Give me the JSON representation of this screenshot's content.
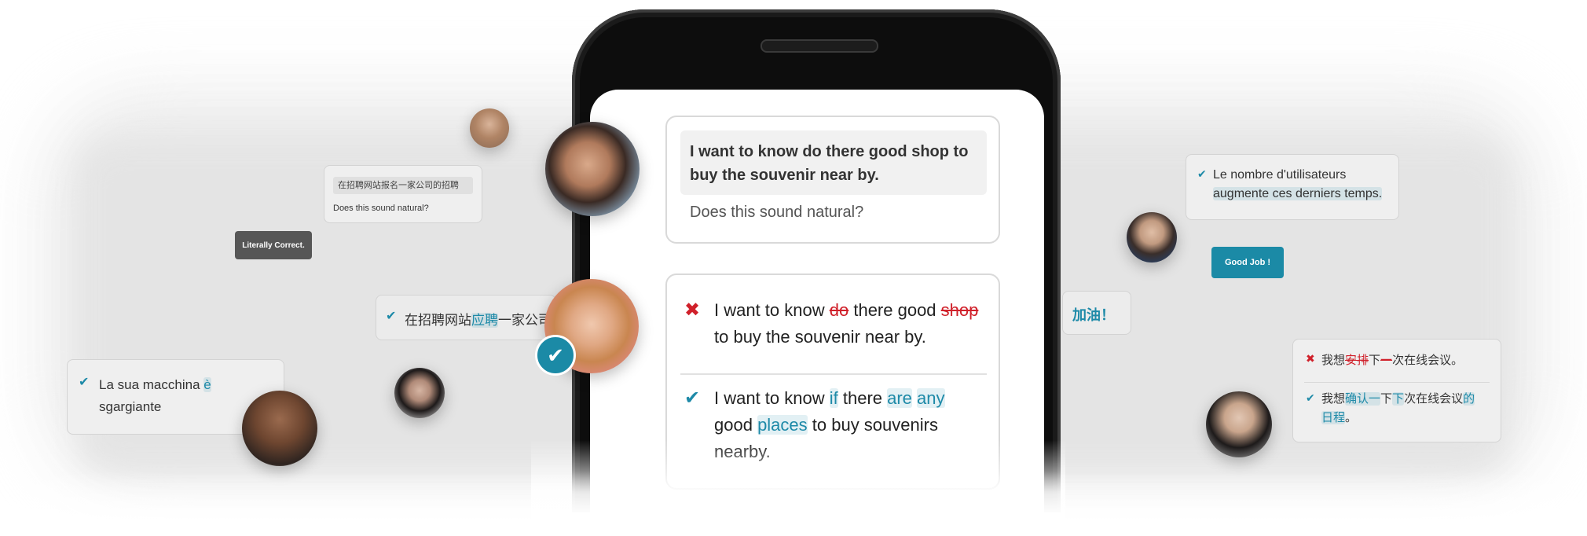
{
  "left": {
    "chinese_question": {
      "text": "在招聘网站报名一家公司的招聘",
      "sub": "Does this sound natural?"
    },
    "literally_correct_badge": "Literally Correct.",
    "chinese_correction": {
      "before": "在招聘网站",
      "hl": "应聘",
      "after": "一家公司"
    },
    "italian_card": {
      "line1_before": "La sua macchina ",
      "line1_hl": "è",
      "line2": "sgargiante"
    }
  },
  "phone": {
    "question": "I want to know do there good shop to buy the souvenir near by.",
    "question_sub": "Does this sound natural?",
    "wrong": {
      "p1": "I want to know ",
      "strike1": "do",
      "p2": " there good ",
      "strike2": "shop",
      "p3": " to buy the souvenir near by."
    },
    "right": {
      "p1": "I want to know ",
      "hl1": "if",
      "p2": " there ",
      "hl2": "are",
      "hl3": "any",
      "p3": "good ",
      "hl4": "places",
      "p4": " to buy souvenirs nearby."
    }
  },
  "right": {
    "french_card": {
      "line1": "Le nombre d'utilisateurs",
      "line2": "augmente ces derniers temps."
    },
    "good_job_badge": "Good Job !",
    "jiayou_card": "加油！",
    "chinese_card": {
      "wrong": {
        "p1": "我想",
        "s1": "安排",
        "p2": "下",
        "s2": "一",
        "p3": "次在线会议。"
      },
      "right": {
        "p1": "我想",
        "h1": "确认一",
        "p2": "下",
        "h2": "下",
        "p3": "次在线会议",
        "h3": "的",
        "line2_h": "日程",
        "line2_p": "。"
      }
    }
  },
  "colors": {
    "accent": "#1e8aa8",
    "error": "#d0202a",
    "badge_dark": "#555555",
    "badge_teal": "#1b8aa6"
  },
  "icons": [
    "check-icon",
    "cross-icon",
    "verified-check-icon"
  ]
}
